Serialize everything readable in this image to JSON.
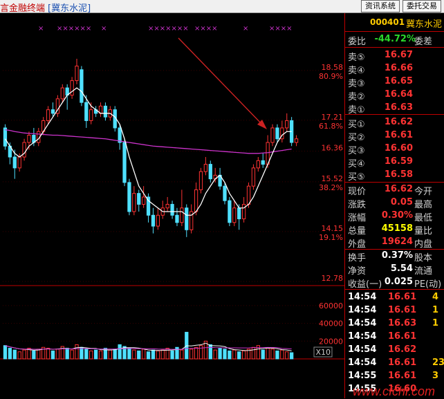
{
  "window": {
    "title_app": "言金融终端",
    "title_stock": "[冀东水泥]",
    "buttons": [
      "资讯系统",
      "委托交易"
    ]
  },
  "quote": {
    "code": "000401",
    "name": "冀东水泥",
    "ratio_label": "委比",
    "ratio_value": "-44.72%",
    "diff_label": "委差",
    "asks": [
      {
        "label": "卖⑤",
        "price": "16.67"
      },
      {
        "label": "卖④",
        "price": "16.66"
      },
      {
        "label": "卖③",
        "price": "16.65"
      },
      {
        "label": "卖②",
        "price": "16.64"
      },
      {
        "label": "卖①",
        "price": "16.63"
      }
    ],
    "bids": [
      {
        "label": "买①",
        "price": "16.62"
      },
      {
        "label": "买②",
        "price": "16.61"
      },
      {
        "label": "买③",
        "price": "16.60"
      },
      {
        "label": "买④",
        "price": "16.59"
      },
      {
        "label": "买⑤",
        "price": "16.58"
      }
    ],
    "stats": [
      {
        "label": "现价",
        "value": "16.62",
        "color": "red",
        "label2": "今开"
      },
      {
        "label": "涨跌",
        "value": "0.05",
        "color": "red",
        "label2": "最高"
      },
      {
        "label": "涨幅",
        "value": "0.30%",
        "color": "red",
        "label2": "最低"
      },
      {
        "label": "总量",
        "value": "45158",
        "color": "yellow",
        "label2": "量比"
      },
      {
        "label": "外盘",
        "value": "19624",
        "color": "red",
        "label2": "内盘"
      }
    ],
    "stats2": [
      {
        "label": "换手",
        "value": "0.37%",
        "color": "white",
        "label2": "股本"
      },
      {
        "label": "净资",
        "value": "5.54",
        "color": "white",
        "label2": "流通"
      },
      {
        "label": "收益(一)",
        "value": "0.025",
        "color": "white",
        "label2": "PE(动)"
      }
    ]
  },
  "ticks": [
    {
      "time": "14:54",
      "price": "16.61",
      "vol": "4"
    },
    {
      "time": "14:54",
      "price": "16.61",
      "vol": "1"
    },
    {
      "time": "14:54",
      "price": "16.63",
      "vol": "1"
    },
    {
      "time": "14:54",
      "price": "16.61",
      "vol": ""
    },
    {
      "time": "14:54",
      "price": "16.62",
      "vol": ""
    },
    {
      "time": "14:54",
      "price": "16.61",
      "vol": "23"
    },
    {
      "time": "14:55",
      "price": "16.61",
      "vol": "3"
    },
    {
      "time": "14:55",
      "price": "16.60",
      "vol": ""
    }
  ],
  "chart_data": {
    "type": "candlestick",
    "price_labels": [
      {
        "price": "18.58",
        "pct": "80.9%"
      },
      {
        "price": "17.21",
        "pct": "61.8%"
      },
      {
        "price": "16.36",
        "pct": ""
      },
      {
        "price": "15.52",
        "pct": "38.2%"
      },
      {
        "price": "14.15",
        "pct": "19.1%"
      },
      {
        "price": "12.78",
        "pct": ""
      }
    ],
    "ylim": [
      12.78,
      18.9
    ],
    "volume_labels": [
      "60000",
      "40000",
      "20000"
    ],
    "volume_unit": "X10",
    "volume_ylim": [
      0,
      70000
    ],
    "candles": [
      {
        "o": 17.0,
        "c": 16.5,
        "h": 17.1,
        "l": 16.4
      },
      {
        "o": 16.5,
        "c": 16.2,
        "h": 16.6,
        "l": 16.0
      },
      {
        "o": 16.2,
        "c": 15.9,
        "h": 16.4,
        "l": 15.6
      },
      {
        "o": 15.9,
        "c": 16.2,
        "h": 16.3,
        "l": 15.8
      },
      {
        "o": 16.2,
        "c": 16.6,
        "h": 16.7,
        "l": 16.1
      },
      {
        "o": 16.6,
        "c": 16.8,
        "h": 16.9,
        "l": 16.4
      },
      {
        "o": 16.8,
        "c": 16.6,
        "h": 17.0,
        "l": 16.5
      },
      {
        "o": 16.6,
        "c": 16.9,
        "h": 17.0,
        "l": 16.5
      },
      {
        "o": 16.9,
        "c": 17.2,
        "h": 17.3,
        "l": 16.8
      },
      {
        "o": 17.2,
        "c": 17.5,
        "h": 17.6,
        "l": 17.1
      },
      {
        "o": 17.5,
        "c": 17.4,
        "h": 17.7,
        "l": 17.3
      },
      {
        "o": 17.4,
        "c": 17.8,
        "h": 17.9,
        "l": 17.3
      },
      {
        "o": 17.8,
        "c": 18.1,
        "h": 18.2,
        "l": 17.7
      },
      {
        "o": 18.1,
        "c": 17.9,
        "h": 18.2,
        "l": 17.5
      },
      {
        "o": 17.9,
        "c": 18.3,
        "h": 18.4,
        "l": 17.8
      },
      {
        "o": 18.3,
        "c": 18.7,
        "h": 18.9,
        "l": 18.2
      },
      {
        "o": 18.6,
        "c": 17.7,
        "h": 18.7,
        "l": 17.6
      },
      {
        "o": 17.7,
        "c": 17.2,
        "h": 17.9,
        "l": 17.0
      },
      {
        "o": 17.2,
        "c": 17.5,
        "h": 17.7,
        "l": 17.1
      },
      {
        "o": 17.5,
        "c": 17.4,
        "h": 17.6,
        "l": 17.3
      },
      {
        "o": 17.4,
        "c": 17.6,
        "h": 17.7,
        "l": 17.3
      },
      {
        "o": 17.6,
        "c": 17.3,
        "h": 17.7,
        "l": 17.2
      },
      {
        "o": 17.3,
        "c": 17.5,
        "h": 17.6,
        "l": 17.2
      },
      {
        "o": 17.5,
        "c": 17.0,
        "h": 17.6,
        "l": 16.9
      },
      {
        "o": 17.0,
        "c": 16.6,
        "h": 17.1,
        "l": 16.4
      },
      {
        "o": 16.6,
        "c": 15.5,
        "h": 16.7,
        "l": 15.4
      },
      {
        "o": 15.5,
        "c": 14.7,
        "h": 15.6,
        "l": 14.6
      },
      {
        "o": 14.7,
        "c": 15.2,
        "h": 15.4,
        "l": 14.6
      },
      {
        "o": 15.2,
        "c": 14.9,
        "h": 15.3,
        "l": 14.7
      },
      {
        "o": 14.9,
        "c": 15.1,
        "h": 15.4,
        "l": 14.8
      },
      {
        "o": 15.1,
        "c": 14.6,
        "h": 15.2,
        "l": 14.4
      },
      {
        "o": 14.6,
        "c": 14.3,
        "h": 14.8,
        "l": 14.1
      },
      {
        "o": 14.3,
        "c": 14.6,
        "h": 14.8,
        "l": 14.2
      },
      {
        "o": 14.6,
        "c": 14.8,
        "h": 15.0,
        "l": 14.5
      },
      {
        "o": 14.8,
        "c": 14.9,
        "h": 15.1,
        "l": 14.7
      },
      {
        "o": 14.9,
        "c": 14.6,
        "h": 15.0,
        "l": 14.5
      },
      {
        "o": 14.6,
        "c": 14.4,
        "h": 14.8,
        "l": 14.3
      },
      {
        "o": 14.4,
        "c": 14.8,
        "h": 15.3,
        "l": 14.3
      },
      {
        "o": 14.8,
        "c": 14.2,
        "h": 14.9,
        "l": 14.0
      },
      {
        "o": 14.2,
        "c": 14.7,
        "h": 14.9,
        "l": 14.1
      },
      {
        "o": 14.7,
        "c": 15.3,
        "h": 15.5,
        "l": 14.6
      },
      {
        "o": 15.3,
        "c": 15.8,
        "h": 15.9,
        "l": 15.2
      },
      {
        "o": 15.8,
        "c": 16.0,
        "h": 16.2,
        "l": 15.7
      },
      {
        "o": 16.0,
        "c": 15.6,
        "h": 16.1,
        "l": 15.5
      },
      {
        "o": 15.6,
        "c": 15.7,
        "h": 15.9,
        "l": 15.5
      },
      {
        "o": 15.7,
        "c": 15.4,
        "h": 15.9,
        "l": 15.3
      },
      {
        "o": 15.4,
        "c": 15.0,
        "h": 15.5,
        "l": 14.9
      },
      {
        "o": 15.0,
        "c": 14.4,
        "h": 15.1,
        "l": 14.3
      },
      {
        "o": 14.4,
        "c": 14.8,
        "h": 15.0,
        "l": 14.3
      },
      {
        "o": 14.8,
        "c": 14.5,
        "h": 14.9,
        "l": 14.2
      },
      {
        "o": 14.5,
        "c": 14.9,
        "h": 15.1,
        "l": 14.4
      },
      {
        "o": 14.9,
        "c": 15.4,
        "h": 15.5,
        "l": 14.8
      },
      {
        "o": 15.4,
        "c": 15.9,
        "h": 16.0,
        "l": 15.3
      },
      {
        "o": 15.9,
        "c": 16.1,
        "h": 16.2,
        "l": 15.8
      },
      {
        "o": 16.1,
        "c": 16.0,
        "h": 16.3,
        "l": 15.9
      },
      {
        "o": 16.0,
        "c": 16.6,
        "h": 16.8,
        "l": 15.9
      },
      {
        "o": 16.6,
        "c": 17.0,
        "h": 17.1,
        "l": 16.5
      },
      {
        "o": 17.0,
        "c": 16.7,
        "h": 17.1,
        "l": 16.6
      },
      {
        "o": 16.7,
        "c": 17.0,
        "h": 17.2,
        "l": 16.6
      },
      {
        "o": 17.0,
        "c": 17.2,
        "h": 17.4,
        "l": 16.9
      },
      {
        "o": 17.2,
        "c": 16.6,
        "h": 17.3,
        "l": 16.5
      },
      {
        "o": 16.6,
        "c": 16.7,
        "h": 16.8,
        "l": 16.5
      }
    ],
    "ma_short": [
      16.7,
      16.5,
      16.3,
      16.2,
      16.3,
      16.5,
      16.6,
      16.7,
      16.9,
      17.1,
      17.3,
      17.5,
      17.7,
      17.9,
      18.0,
      18.1,
      18.0,
      17.8,
      17.6,
      17.5,
      17.4,
      17.4,
      17.4,
      17.3,
      17.1,
      16.7,
      16.2,
      15.8,
      15.4,
      15.2,
      15.0,
      14.9,
      14.8,
      14.7,
      14.7,
      14.7,
      14.7,
      14.7,
      14.6,
      14.6,
      14.7,
      14.9,
      15.2,
      15.4,
      15.6,
      15.7,
      15.5,
      15.2,
      15.0,
      14.8,
      14.8,
      14.9,
      15.1,
      15.4,
      15.7,
      16.0,
      16.3,
      16.6,
      16.8,
      16.9,
      16.9
    ],
    "ma_long": [
      16.95,
      16.93,
      16.9,
      16.88,
      16.86,
      16.85,
      16.84,
      16.83,
      16.82,
      16.81,
      16.8,
      16.8,
      16.79,
      16.78,
      16.77,
      16.76,
      16.75,
      16.74,
      16.73,
      16.72,
      16.71,
      16.7,
      16.68,
      16.66,
      16.64,
      16.62,
      16.6,
      16.58,
      16.56,
      16.54,
      16.52,
      16.5,
      16.49,
      16.48,
      16.47,
      16.46,
      16.45,
      16.44,
      16.43,
      16.42,
      16.41,
      16.4,
      16.39,
      16.38,
      16.37,
      16.36,
      16.35,
      16.34,
      16.33,
      16.32,
      16.31,
      16.3,
      16.3,
      16.3,
      16.31,
      16.32,
      16.34,
      16.36,
      16.38,
      16.4,
      16.42
    ],
    "volumes": [
      15,
      12,
      10,
      8,
      10,
      12,
      9,
      11,
      13,
      12,
      9,
      11,
      14,
      12,
      10,
      16,
      13,
      11,
      9,
      10,
      9,
      12,
      10,
      11,
      16,
      14,
      12,
      10,
      9,
      11,
      8,
      10,
      9,
      10,
      12,
      9,
      13,
      10,
      30,
      11,
      13,
      15,
      20,
      16,
      10,
      12,
      11,
      9,
      10,
      8,
      9,
      11,
      13,
      15,
      10,
      12,
      11,
      9,
      10,
      8,
      7
    ],
    "signal_marks": [
      "×",
      "××××××",
      "×",
      "×××××××",
      "××××",
      "×",
      "××××"
    ]
  },
  "watermark": "www.cfchi.com"
}
